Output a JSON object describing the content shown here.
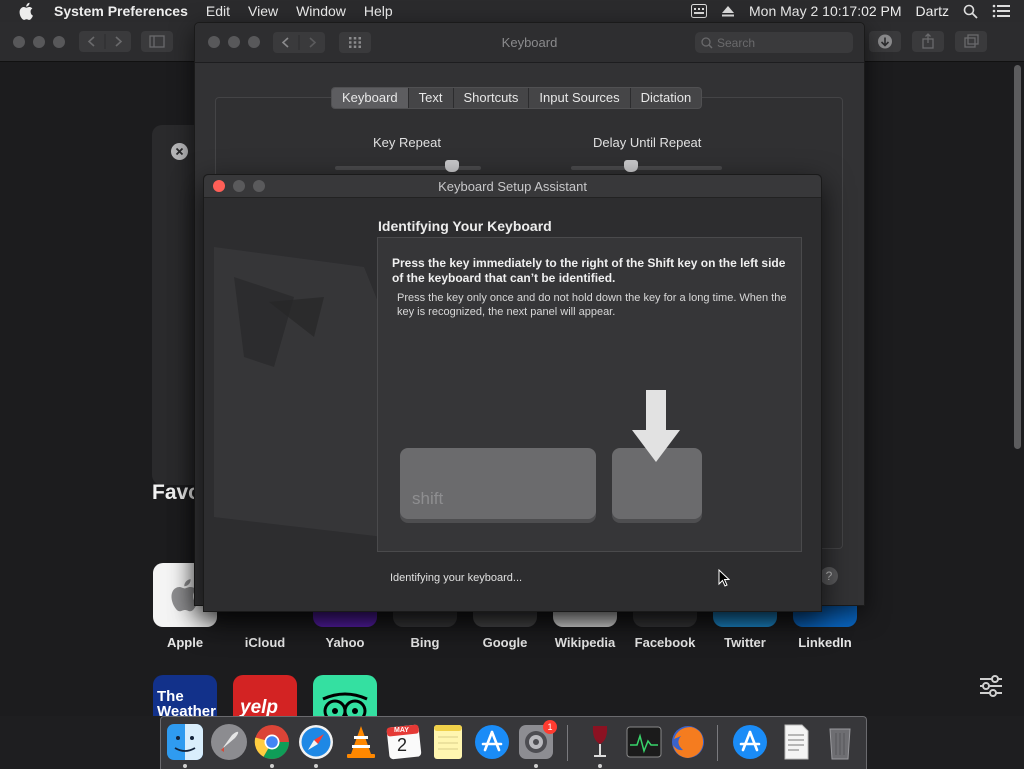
{
  "menubar": {
    "app_name": "System Preferences",
    "menus": [
      "Edit",
      "View",
      "Window",
      "Help"
    ],
    "datetime": "Mon May 2  10:17:02 PM",
    "user": "Dartz"
  },
  "system_preferences": {
    "title": "Keyboard",
    "search_placeholder": "Search",
    "tabs": [
      "Keyboard",
      "Text",
      "Shortcuts",
      "Input Sources",
      "Dictation"
    ],
    "active_tab": "Keyboard",
    "key_repeat_label": "Key Repeat",
    "delay_label": "Delay Until Repeat",
    "key_repeat_value": 0.8,
    "delay_value": 0.4
  },
  "assistant": {
    "title": "Keyboard Setup Assistant",
    "heading": "Identifying Your Keyboard",
    "instruction": "Press the key immediately to the right of the Shift key on the left side of the keyboard that can’t be identified.",
    "hint": "Press the key only once and do not hold down the key for a long time. When the key is recognized, the next panel will appear.",
    "shift_key_label": "shift",
    "status": "Identifying your keyboard...",
    "help_label": "?"
  },
  "safari": {
    "favorites_heading": "Favo",
    "favorites": [
      "Apple",
      "iCloud",
      "Yahoo",
      "Bing",
      "Google",
      "Wikipedia",
      "Facebook",
      "Twitter",
      "LinkedIn"
    ],
    "second_row": [
      {
        "name": "The Weather Channel",
        "label": "The Weather"
      },
      {
        "name": "Yelp",
        "label": "yelp"
      },
      {
        "name": "TripAdvisor",
        "label": ""
      }
    ]
  },
  "dock": {
    "apps": [
      "Finder",
      "Launchpad",
      "Google Chrome",
      "Safari",
      "VLC",
      "Calendar",
      "Notes",
      "App Store",
      "System Preferences",
      "Wine",
      "Activity Monitor",
      "Firefox",
      "App Store Utility",
      "Document",
      "Trash"
    ],
    "calendar_month": "MAY",
    "calendar_day": "2",
    "badge_count": "1"
  },
  "colors": {
    "close": "#ff5f57",
    "minimize": "#5a5a5c",
    "zoom": "#5a5a5c"
  }
}
